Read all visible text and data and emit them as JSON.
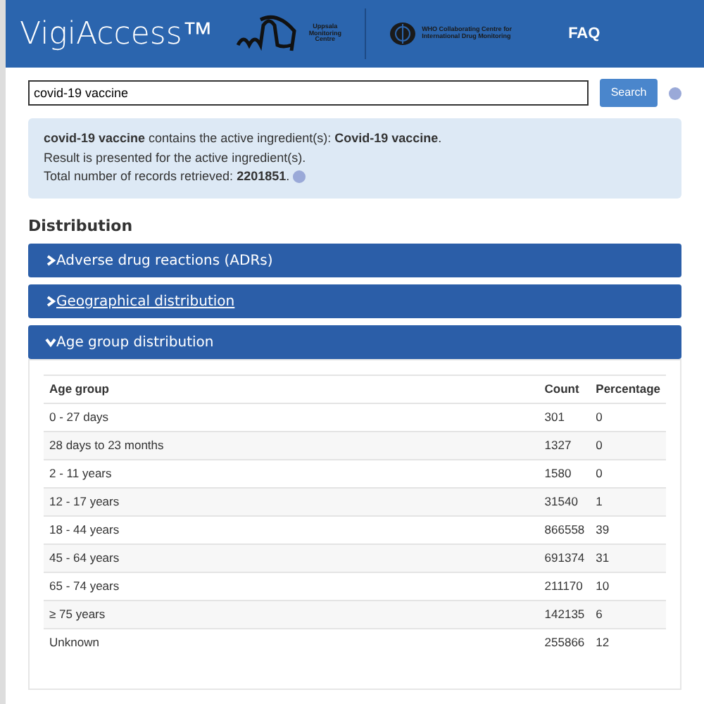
{
  "header": {
    "brand": "VigiAccess™",
    "umc_logo": {
      "lines": [
        "Uppsala",
        "Monitoring",
        "Centre"
      ]
    },
    "who_logo": {
      "lines": [
        "WHO Collaborating Centre for",
        "International Drug Monitoring"
      ]
    },
    "nav": [
      "FAQ"
    ]
  },
  "search": {
    "value": "covid-19 vaccine",
    "button": "Search"
  },
  "info": {
    "lines": [
      "**covid-19 vaccine** contains the active ingredient(s): **Covid-19 vaccine**.",
      "Result is presented for the active ingredient(s).",
      "Total number of records retrieved: **2201851**."
    ]
  },
  "distribution": {
    "title": "Distribution",
    "panels": [
      {
        "title": "Adverse drug reactions (ADRs)",
        "expanded": false,
        "underlined": false
      },
      {
        "title": "Geographical distribution",
        "expanded": false,
        "underlined": true
      },
      {
        "title": "Age group distribution",
        "expanded": true,
        "underlined": false,
        "table": {
          "columns": [
            "Age group",
            "Count",
            "Percentage"
          ],
          "rows": [
            [
              "0 - 27 days",
              "301",
              "0"
            ],
            [
              "28 days to 23 months",
              "1327",
              "0"
            ],
            [
              "2 - 11 years",
              "1580",
              "0"
            ],
            [
              "12 - 17 years",
              "31540",
              "1"
            ],
            [
              "18 - 44 years",
              "866558",
              "39"
            ],
            [
              "45 - 64 years",
              "691374",
              "31"
            ],
            [
              "65 - 74 years",
              "211170",
              "10"
            ],
            [
              "≥ 75 years",
              "142135",
              "6"
            ],
            [
              "Unknown",
              "255866",
              "12"
            ]
          ]
        }
      }
    ]
  }
}
